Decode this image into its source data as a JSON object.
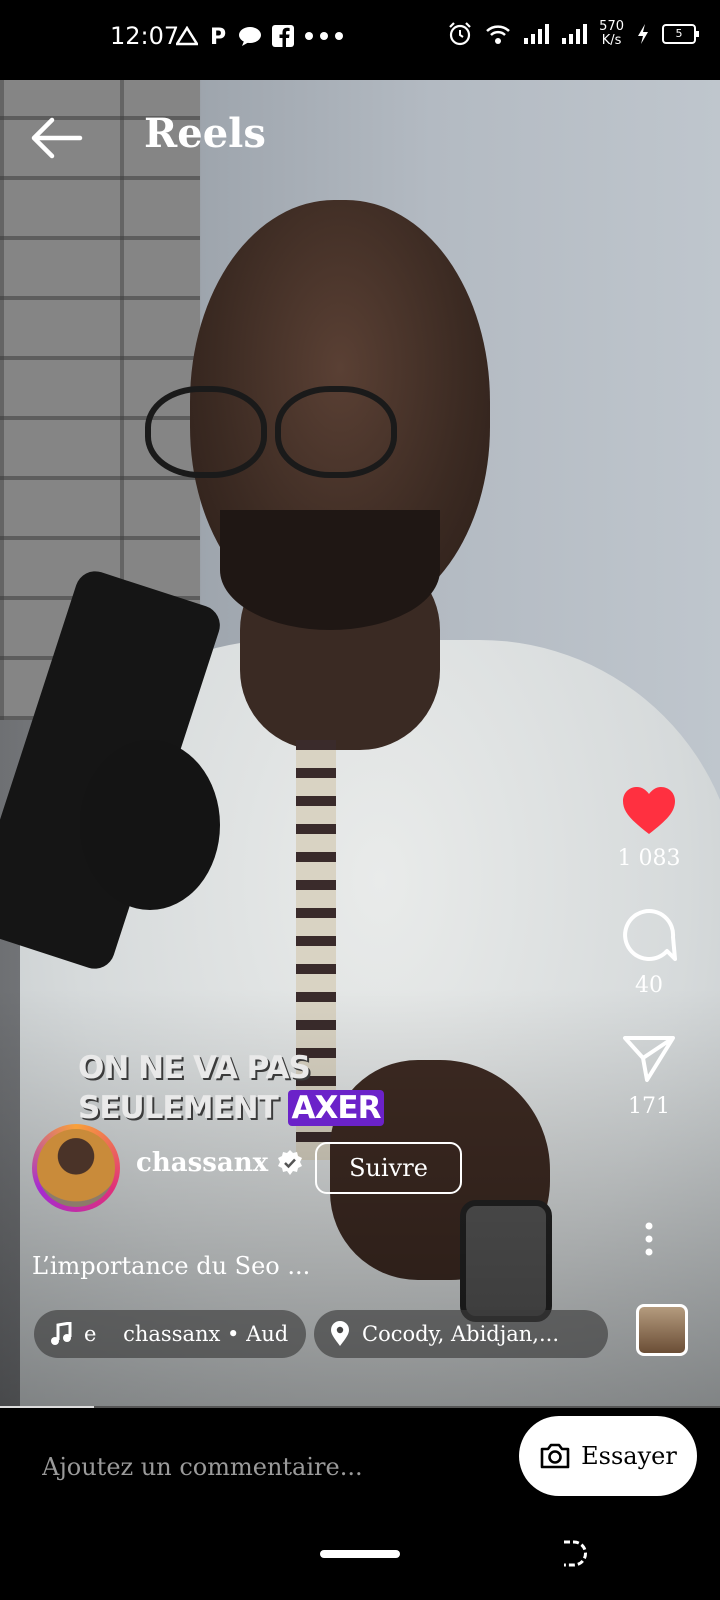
{
  "status_bar": {
    "time": "12:07",
    "net_speed_value": "570",
    "net_speed_unit": "K/s",
    "battery": "5"
  },
  "header": {
    "title": "Reels"
  },
  "reel": {
    "likes": "1 083",
    "comments": "40",
    "shares": "171",
    "caption_line1": "ON NE VA PAS",
    "caption_line2": "SEULEMENT",
    "caption_highlight": "AXER",
    "author": "chassanx",
    "follow_label": "Suivre",
    "description": "L’importance du Seo ...",
    "audio": "e    chassanx • Aud",
    "location": "Cocody, Abidjan,...",
    "progress": 0.13
  },
  "comment_bar": {
    "placeholder": "Ajoutez un commentaire...",
    "try_label": "Essayer"
  },
  "colors": {
    "like": "#ff3040",
    "caption_highlight": "#6b22c9"
  }
}
